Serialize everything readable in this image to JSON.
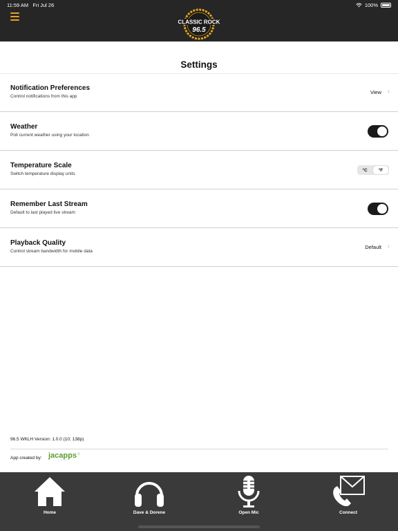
{
  "status_bar": {
    "time": "11:59 AM",
    "date": "Fri Jul 26",
    "battery": "100%"
  },
  "header": {
    "logo_top": "CLASSIC ROCK",
    "logo_bottom": "96.5"
  },
  "page": {
    "title": "Settings"
  },
  "settings": [
    {
      "title": "Notification Preferences",
      "subtitle": "Control notifications from this app",
      "value": "View"
    },
    {
      "title": "Weather",
      "subtitle": "Poll current weather using your location",
      "toggle": true
    },
    {
      "title": "Temperature Scale",
      "subtitle": "Switch temperature display units",
      "options": [
        "°C",
        "°F"
      ],
      "selected": "°F"
    },
    {
      "title": "Remember Last Stream",
      "subtitle": "Default to last played live stream",
      "toggle": true
    },
    {
      "title": "Playback Quality",
      "subtitle": "Control stream bandwidth for mobile data",
      "value": "Default"
    }
  ],
  "footer": {
    "version": "96.5 WKLH Version: 1.0.0 (10; 138p)",
    "created_by": "App created by:",
    "brand": "jacapps"
  },
  "tabs": [
    {
      "label": "Home",
      "icon": "home-icon"
    },
    {
      "label": "Dave & Dorene",
      "icon": "headphones-icon"
    },
    {
      "label": "Open Mic",
      "icon": "microphone-icon"
    },
    {
      "label": "Connect",
      "icon": "phone-mail-icon"
    }
  ],
  "colors": {
    "topbar": "#262626",
    "accent": "#e5a323",
    "tabbar": "#3a3a3a",
    "toggle_on": "#1a1a1a",
    "brand_green": "#5a9c2e"
  }
}
